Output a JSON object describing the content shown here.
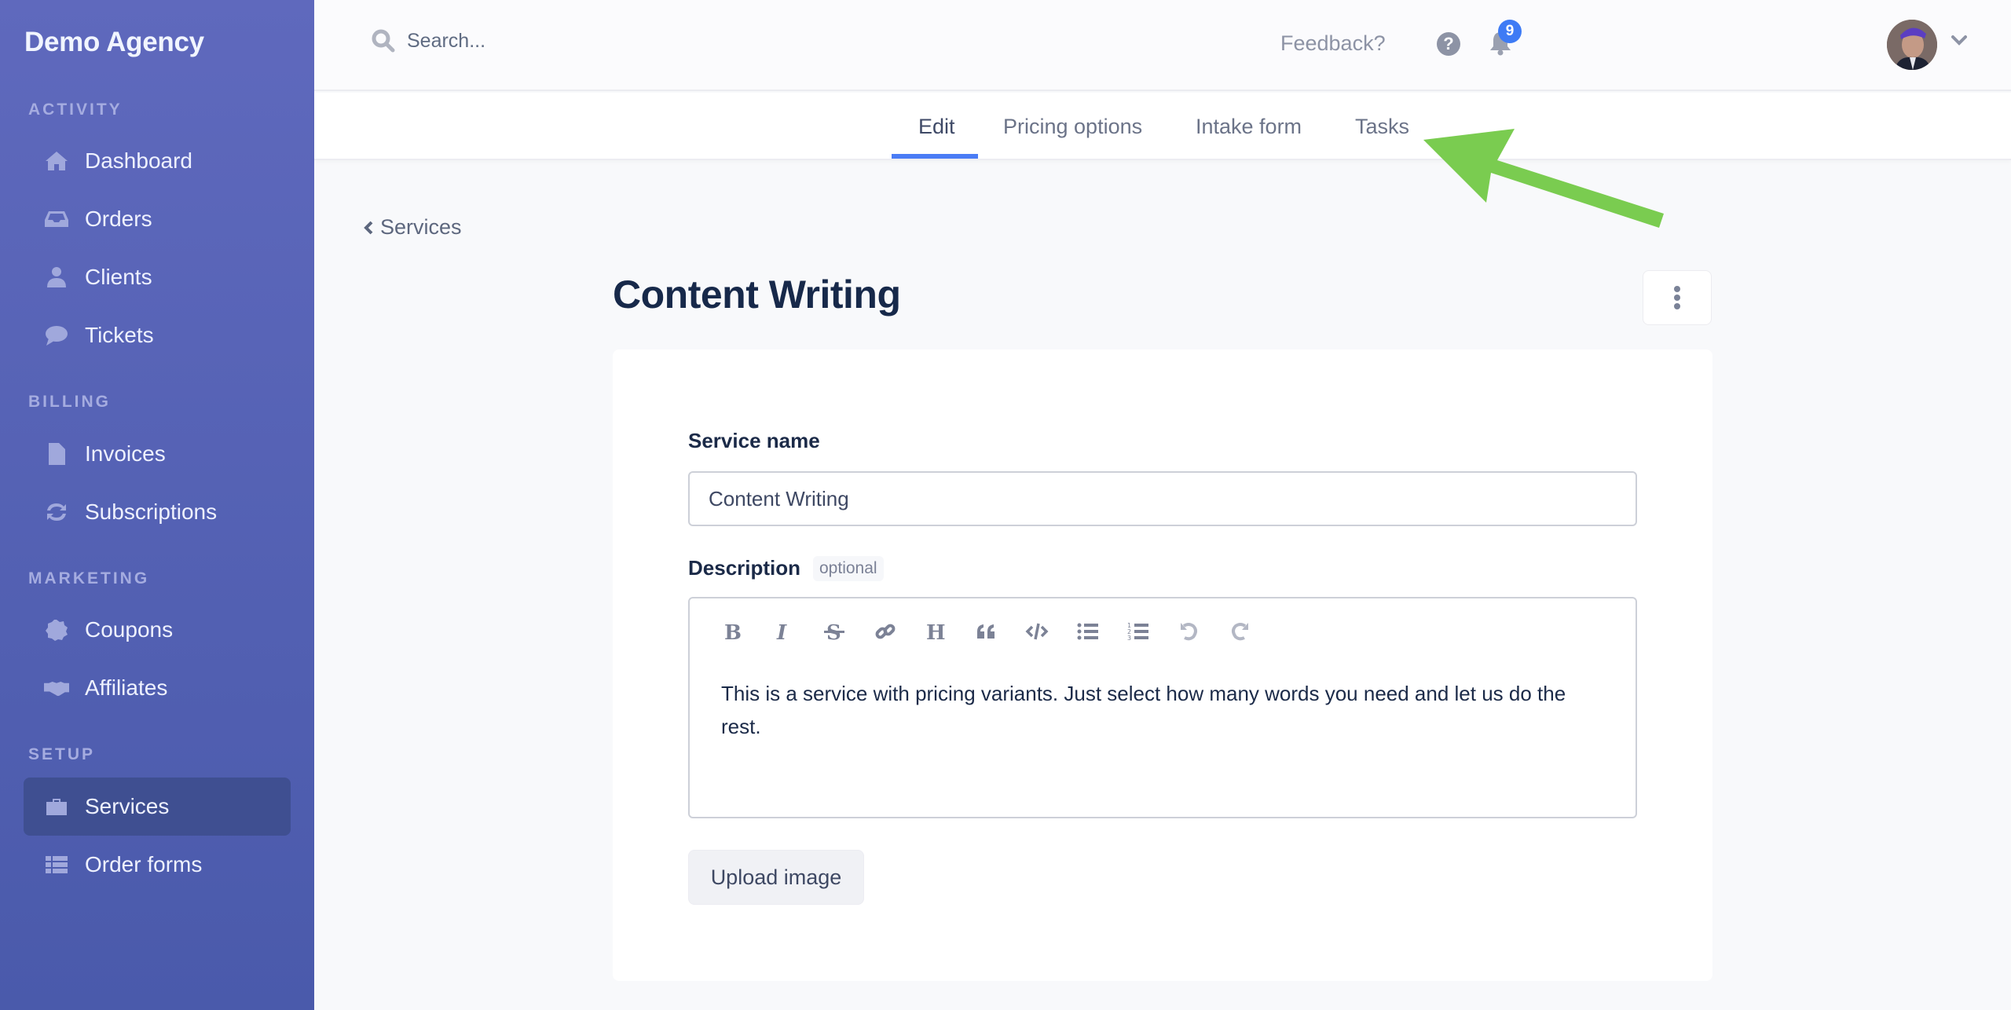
{
  "sidebar": {
    "brand": "Demo Agency",
    "sections": [
      {
        "label": "ACTIVITY",
        "items": [
          {
            "label": "Dashboard",
            "icon": "home-icon"
          },
          {
            "label": "Orders",
            "icon": "inbox-icon"
          },
          {
            "label": "Clients",
            "icon": "user-icon"
          },
          {
            "label": "Tickets",
            "icon": "chat-bubble-icon"
          }
        ]
      },
      {
        "label": "BILLING",
        "items": [
          {
            "label": "Invoices",
            "icon": "file-icon"
          },
          {
            "label": "Subscriptions",
            "icon": "refresh-icon"
          }
        ]
      },
      {
        "label": "MARKETING",
        "items": [
          {
            "label": "Coupons",
            "icon": "percent-badge-icon"
          },
          {
            "label": "Affiliates",
            "icon": "handshake-icon"
          }
        ]
      },
      {
        "label": "SETUP",
        "items": [
          {
            "label": "Services",
            "icon": "toolbox-icon",
            "active": true
          },
          {
            "label": "Order forms",
            "icon": "table-list-icon"
          }
        ]
      }
    ]
  },
  "topbar": {
    "search_placeholder": "Search...",
    "feedback_label": "Feedback?",
    "help_icon_glyph": "?",
    "notifications_count": "9",
    "accent_color": "#3e7bf5"
  },
  "tabs": [
    {
      "label": "Edit",
      "active": true
    },
    {
      "label": "Pricing options",
      "active": false
    },
    {
      "label": "Intake form",
      "active": false
    },
    {
      "label": "Tasks",
      "active": false
    }
  ],
  "main": {
    "back_label": "Services",
    "title": "Content Writing",
    "form": {
      "service_name_label": "Service name",
      "service_name_value": "Content Writing",
      "description_label": "Description",
      "optional_tag": "optional",
      "description_text": "This is a service with pricing variants. Just select how many words you need and let us do the rest.",
      "toolbar": [
        "bold",
        "italic",
        "strikethrough",
        "link",
        "heading",
        "quote",
        "code",
        "bullet-list",
        "numbered-list",
        "undo",
        "redo"
      ],
      "upload_label": "Upload image"
    }
  },
  "annotation": {
    "type": "arrow",
    "target": "Tasks tab",
    "color": "#7acc50"
  }
}
